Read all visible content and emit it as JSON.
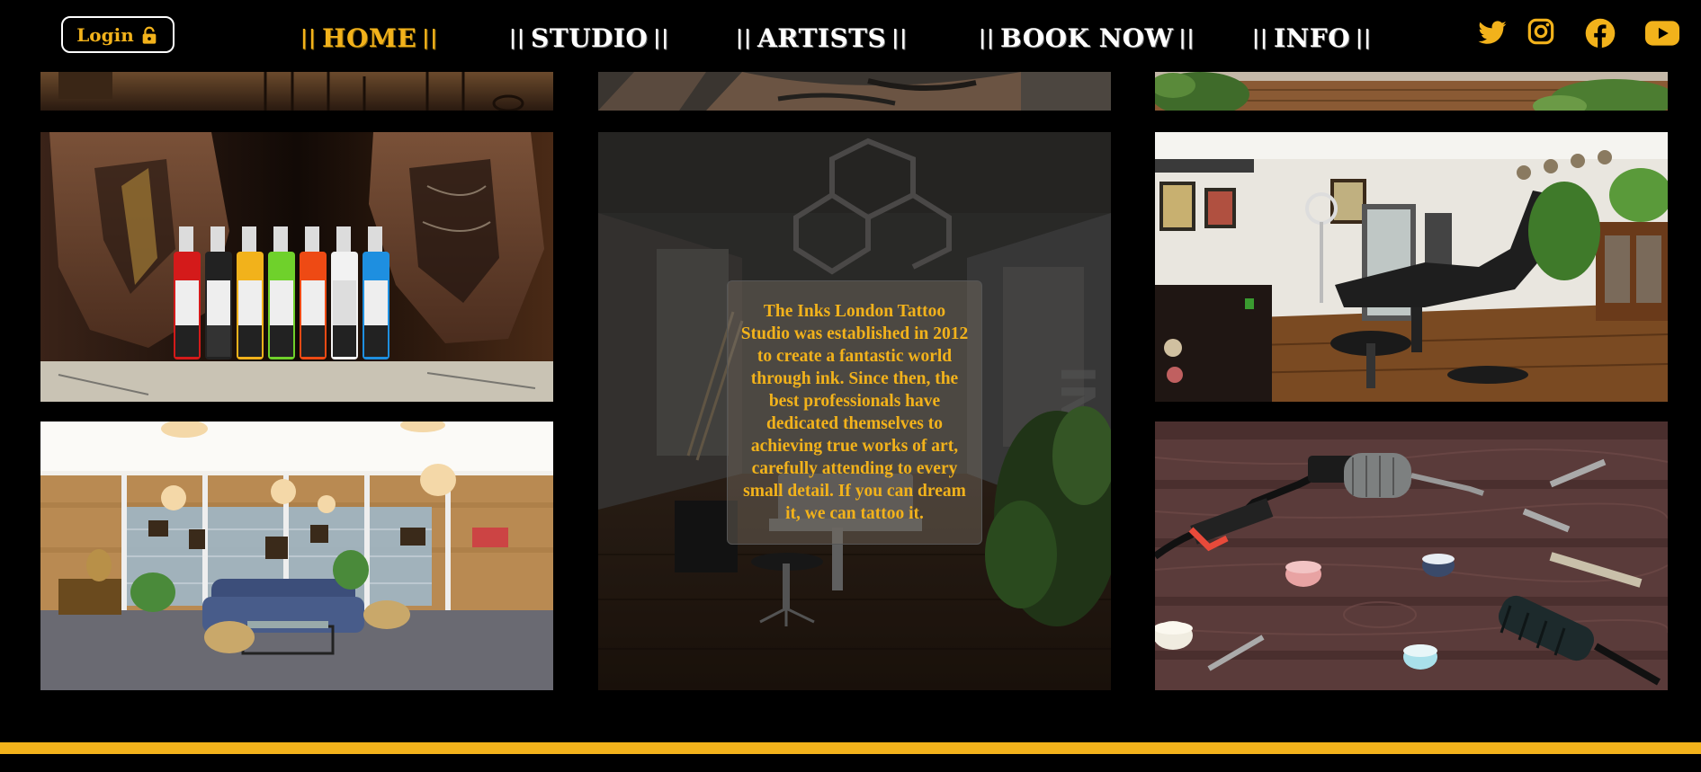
{
  "nav": {
    "login_label": "Login",
    "items": [
      {
        "label": "HOME",
        "active": true
      },
      {
        "label": "STUDIO",
        "active": false
      },
      {
        "label": "ARTISTS",
        "active": false
      },
      {
        "label": "BOOK NOW",
        "active": false
      },
      {
        "label": "INFO",
        "active": false
      }
    ],
    "separator": "||",
    "social_icons": [
      "twitter-icon",
      "instagram-icon",
      "facebook-icon",
      "youtube-icon"
    ]
  },
  "about": {
    "text": "The Inks London Tattoo Studio was established in 2012 to create a fantastic world through ink. Since then, the best professionals have dedicated themselves to achieving true works of art, carefully attending to every small detail. If you can dream it, we can tattoo it."
  },
  "gallery": {
    "photos": [
      "studio-chairs-photo",
      "tattooed-arm-photo",
      "plants-floor-photo",
      "ink-bottles-photo",
      "studio-interior-photo",
      "tattoo-station-photo",
      "lounge-photo",
      "tattoo-machine-photo"
    ]
  },
  "colors": {
    "accent": "#f2b21b",
    "background": "#000000",
    "nav_text": "#ffffff"
  }
}
